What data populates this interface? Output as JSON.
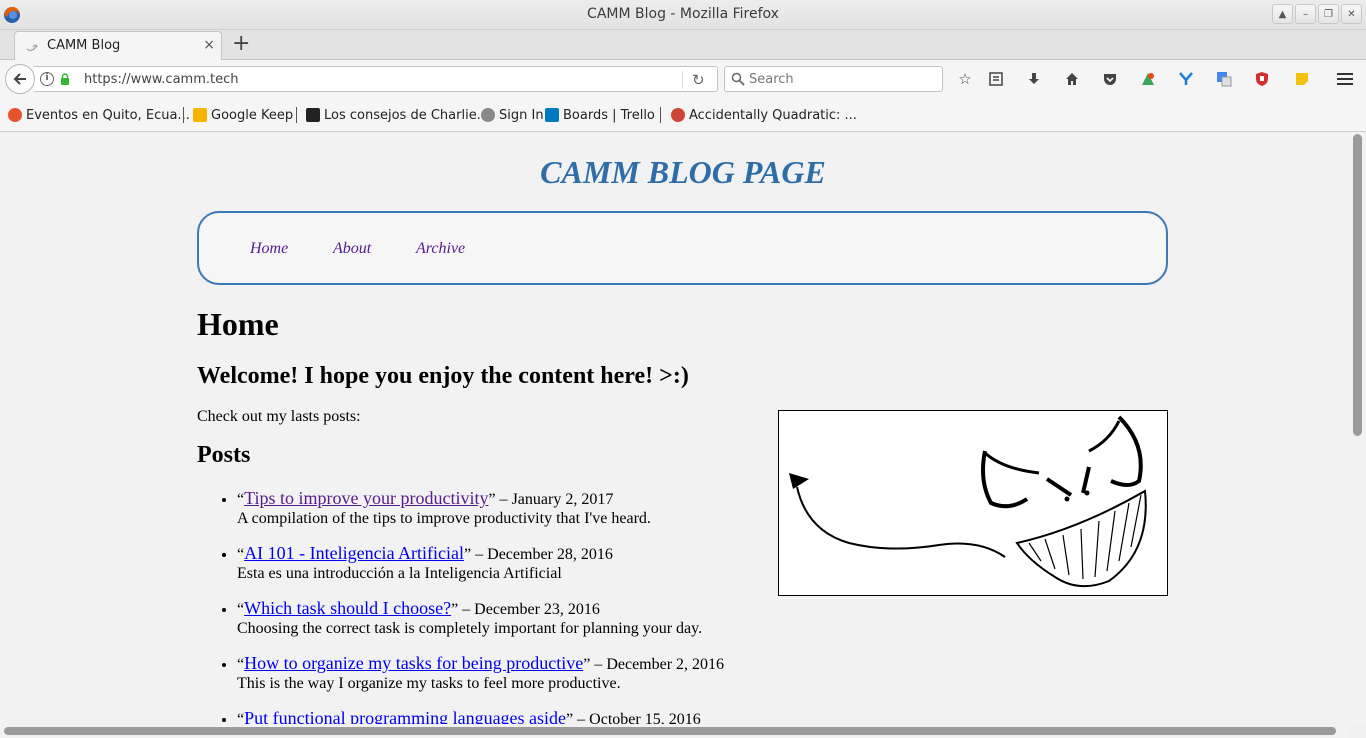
{
  "window": {
    "title": "CAMM Blog - Mozilla Firefox"
  },
  "tab": {
    "title": "CAMM Blog",
    "close": "×",
    "new_tab": "+"
  },
  "navbar": {
    "url": "https://www.camm.tech",
    "search_placeholder": "Search"
  },
  "bookmarks": [
    {
      "label": "Eventos en Quito, Ecua...",
      "icon_color": "#e8532c"
    },
    {
      "label": "Google Keep",
      "icon_color": "#f4b400"
    },
    {
      "label": "Los consejos de Charlie...",
      "icon_color": "#222222"
    },
    {
      "label": "Sign In",
      "icon_color": "#8a8a8a"
    },
    {
      "label": "Boards | Trello",
      "icon_color": "#0079bf"
    },
    {
      "label": "Accidentally Quadratic: ...",
      "icon_color": "#d0453a"
    }
  ],
  "page": {
    "site_title": "CAMM BLOG PAGE",
    "nav": [
      "Home",
      "About",
      "Archive"
    ],
    "heading": "Home",
    "welcome": "Welcome! I hope you enjoy the content here! >:)",
    "check_out": "Check out my lasts posts:",
    "posts_heading": "Posts",
    "posts": [
      {
        "title": "Tips to improve your productivity",
        "date": "January 2, 2017",
        "summary": "A compilation of the tips to improve productivity that I've heard."
      },
      {
        "title": "AI 101 - Inteligencia Artificial",
        "date": "December 28, 2016",
        "summary": "Esta es una introducción a la Inteligencia Artificial"
      },
      {
        "title": "Which task should I choose?",
        "date": "December 23, 2016",
        "summary": "Choosing the correct task is completely important for planning your day."
      },
      {
        "title": "How to organize my tasks for being productive",
        "date": "December 2, 2016",
        "summary": "This is the way I organize my tasks to feel more productive."
      },
      {
        "title": "Put functional programming languages aside",
        "date": "October 15, 2016",
        "summary": ""
      }
    ]
  },
  "colors": {
    "site_title": "#2f6da8",
    "nav_border": "#3b78b4",
    "link": "#0000ee",
    "visited_link": "#551a8b"
  }
}
